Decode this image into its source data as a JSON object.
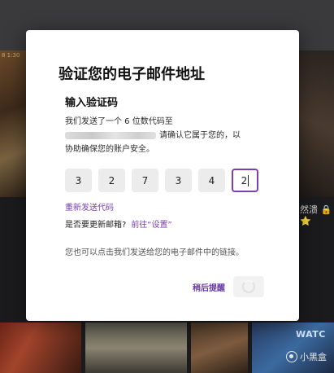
{
  "background": {
    "corner_text": "8 1:30",
    "right_text": "然溃 🔒 ⭐",
    "bottom_text": "WATC",
    "watermark": "小黑盒"
  },
  "modal": {
    "title": "验证您的电子邮件地址",
    "subtitle": "输入验证码",
    "desc_line1": "我们发送了一个 6 位数代码至",
    "desc_line2_suffix": "请确认它属于您的，以",
    "desc_line3": "协助确保您的账户安全。",
    "code_digits": [
      "3",
      "2",
      "7",
      "3",
      "4",
      "2"
    ],
    "resend_label": "重新发送代码",
    "update_question": "是否要更新邮箱?",
    "update_link": "前往“设置”",
    "note": "您也可以点击我们发送给您的电子邮件中的链接。",
    "later_label": "稍后提醒",
    "accent_color": "#7a3fb2"
  }
}
